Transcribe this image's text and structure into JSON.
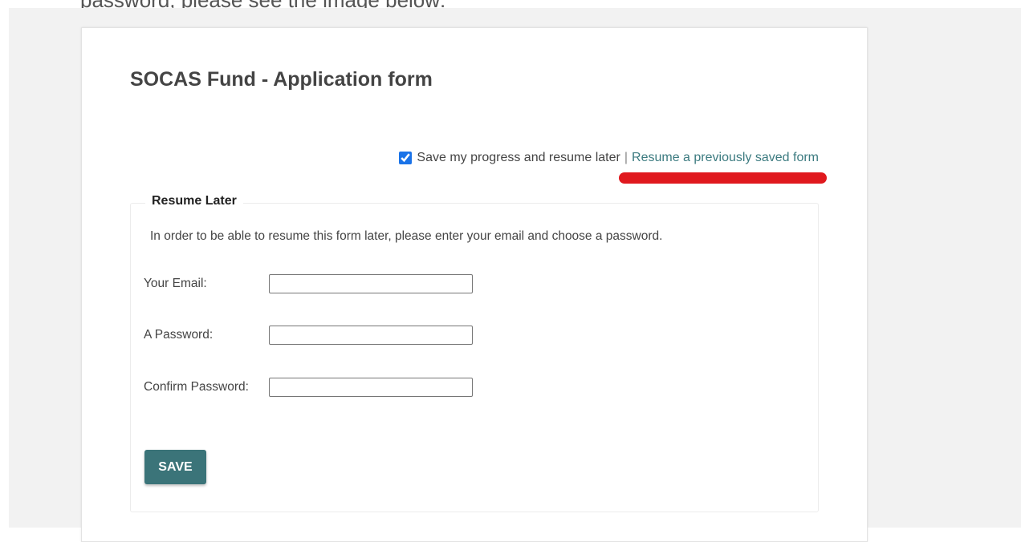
{
  "caption_cropped": "password, please see the image below:",
  "form": {
    "title": "SOCAS Fund - Application form",
    "save_progress_label": "Save my progress and resume later",
    "separator": "|",
    "resume_link": "Resume a previously saved form",
    "save_progress_checked": true
  },
  "resume_later": {
    "legend": "Resume Later",
    "instructions": "In order to be able to resume this form later, please enter your email and choose a password.",
    "fields": [
      {
        "label": "Your Email:",
        "value": "",
        "placeholder": ""
      },
      {
        "label": "A Password:",
        "value": "",
        "placeholder": ""
      },
      {
        "label": "Confirm Password:",
        "value": "",
        "placeholder": ""
      }
    ],
    "save_button": "SAVE"
  },
  "colors": {
    "accent": "#3b7479",
    "link": "#3c7b80",
    "highlight": "#e0191e"
  }
}
